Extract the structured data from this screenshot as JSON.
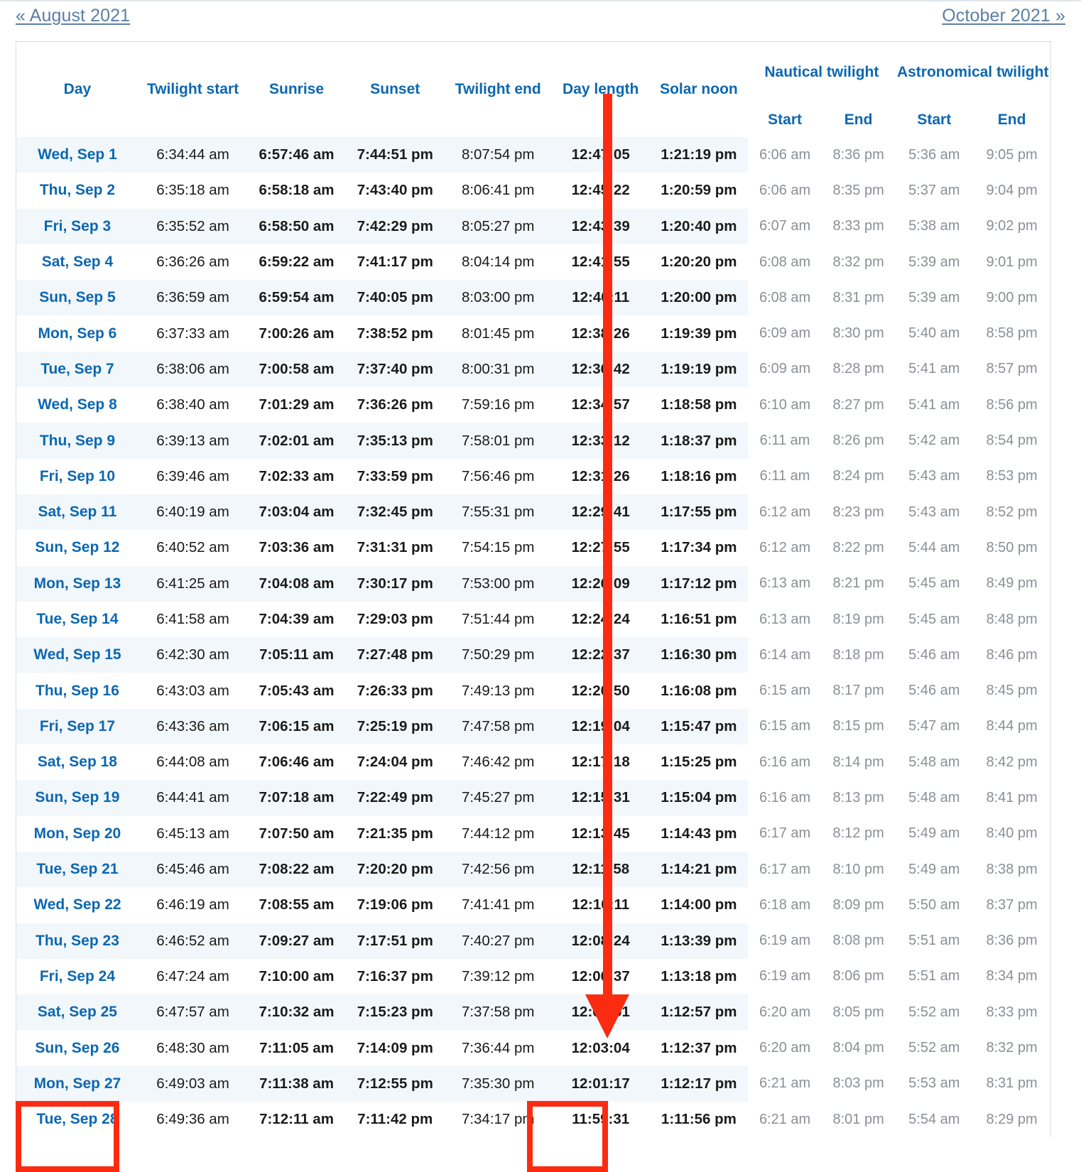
{
  "nav": {
    "prev_label": "« August 2021",
    "next_label": "October 2021 »"
  },
  "table": {
    "headers": {
      "day": "Day",
      "twilight_start": "Twilight start",
      "sunrise": "Sunrise",
      "sunset": "Sunset",
      "twilight_end": "Twilight end",
      "day_length": "Day length",
      "solar_noon": "Solar noon",
      "nautical_group": "Nautical twilight",
      "astronomical_group": "Astronomical twilight",
      "nautical_start": "Start",
      "nautical_end": "End",
      "astronomical_start": "Start",
      "astronomical_end": "End"
    },
    "rows": [
      {
        "day": "Wed, Sep 1",
        "twilight_start": "6:34:44 am",
        "sunrise": "6:57:46 am",
        "sunset": "7:44:51 pm",
        "twilight_end": "8:07:54 pm",
        "day_length": "12:47:05",
        "solar_noon": "1:21:19 pm",
        "nautical_start": "6:06 am",
        "nautical_end": "8:36 pm",
        "astronomical_start": "5:36 am",
        "astronomical_end": "9:05 pm"
      },
      {
        "day": "Thu, Sep 2",
        "twilight_start": "6:35:18 am",
        "sunrise": "6:58:18 am",
        "sunset": "7:43:40 pm",
        "twilight_end": "8:06:41 pm",
        "day_length": "12:45:22",
        "solar_noon": "1:20:59 pm",
        "nautical_start": "6:06 am",
        "nautical_end": "8:35 pm",
        "astronomical_start": "5:37 am",
        "astronomical_end": "9:04 pm"
      },
      {
        "day": "Fri, Sep 3",
        "twilight_start": "6:35:52 am",
        "sunrise": "6:58:50 am",
        "sunset": "7:42:29 pm",
        "twilight_end": "8:05:27 pm",
        "day_length": "12:43:39",
        "solar_noon": "1:20:40 pm",
        "nautical_start": "6:07 am",
        "nautical_end": "8:33 pm",
        "astronomical_start": "5:38 am",
        "astronomical_end": "9:02 pm"
      },
      {
        "day": "Sat, Sep 4",
        "twilight_start": "6:36:26 am",
        "sunrise": "6:59:22 am",
        "sunset": "7:41:17 pm",
        "twilight_end": "8:04:14 pm",
        "day_length": "12:41:55",
        "solar_noon": "1:20:20 pm",
        "nautical_start": "6:08 am",
        "nautical_end": "8:32 pm",
        "astronomical_start": "5:39 am",
        "astronomical_end": "9:01 pm"
      },
      {
        "day": "Sun, Sep 5",
        "twilight_start": "6:36:59 am",
        "sunrise": "6:59:54 am",
        "sunset": "7:40:05 pm",
        "twilight_end": "8:03:00 pm",
        "day_length": "12:40:11",
        "solar_noon": "1:20:00 pm",
        "nautical_start": "6:08 am",
        "nautical_end": "8:31 pm",
        "astronomical_start": "5:39 am",
        "astronomical_end": "9:00 pm"
      },
      {
        "day": "Mon, Sep 6",
        "twilight_start": "6:37:33 am",
        "sunrise": "7:00:26 am",
        "sunset": "7:38:52 pm",
        "twilight_end": "8:01:45 pm",
        "day_length": "12:38:26",
        "solar_noon": "1:19:39 pm",
        "nautical_start": "6:09 am",
        "nautical_end": "8:30 pm",
        "astronomical_start": "5:40 am",
        "astronomical_end": "8:58 pm"
      },
      {
        "day": "Tue, Sep 7",
        "twilight_start": "6:38:06 am",
        "sunrise": "7:00:58 am",
        "sunset": "7:37:40 pm",
        "twilight_end": "8:00:31 pm",
        "day_length": "12:36:42",
        "solar_noon": "1:19:19 pm",
        "nautical_start": "6:09 am",
        "nautical_end": "8:28 pm",
        "astronomical_start": "5:41 am",
        "astronomical_end": "8:57 pm"
      },
      {
        "day": "Wed, Sep 8",
        "twilight_start": "6:38:40 am",
        "sunrise": "7:01:29 am",
        "sunset": "7:36:26 pm",
        "twilight_end": "7:59:16 pm",
        "day_length": "12:34:57",
        "solar_noon": "1:18:58 pm",
        "nautical_start": "6:10 am",
        "nautical_end": "8:27 pm",
        "astronomical_start": "5:41 am",
        "astronomical_end": "8:56 pm"
      },
      {
        "day": "Thu, Sep 9",
        "twilight_start": "6:39:13 am",
        "sunrise": "7:02:01 am",
        "sunset": "7:35:13 pm",
        "twilight_end": "7:58:01 pm",
        "day_length": "12:33:12",
        "solar_noon": "1:18:37 pm",
        "nautical_start": "6:11 am",
        "nautical_end": "8:26 pm",
        "astronomical_start": "5:42 am",
        "astronomical_end": "8:54 pm"
      },
      {
        "day": "Fri, Sep 10",
        "twilight_start": "6:39:46 am",
        "sunrise": "7:02:33 am",
        "sunset": "7:33:59 pm",
        "twilight_end": "7:56:46 pm",
        "day_length": "12:31:26",
        "solar_noon": "1:18:16 pm",
        "nautical_start": "6:11 am",
        "nautical_end": "8:24 pm",
        "astronomical_start": "5:43 am",
        "astronomical_end": "8:53 pm"
      },
      {
        "day": "Sat, Sep 11",
        "twilight_start": "6:40:19 am",
        "sunrise": "7:03:04 am",
        "sunset": "7:32:45 pm",
        "twilight_end": "7:55:31 pm",
        "day_length": "12:29:41",
        "solar_noon": "1:17:55 pm",
        "nautical_start": "6:12 am",
        "nautical_end": "8:23 pm",
        "astronomical_start": "5:43 am",
        "astronomical_end": "8:52 pm"
      },
      {
        "day": "Sun, Sep 12",
        "twilight_start": "6:40:52 am",
        "sunrise": "7:03:36 am",
        "sunset": "7:31:31 pm",
        "twilight_end": "7:54:15 pm",
        "day_length": "12:27:55",
        "solar_noon": "1:17:34 pm",
        "nautical_start": "6:12 am",
        "nautical_end": "8:22 pm",
        "astronomical_start": "5:44 am",
        "astronomical_end": "8:50 pm"
      },
      {
        "day": "Mon, Sep 13",
        "twilight_start": "6:41:25 am",
        "sunrise": "7:04:08 am",
        "sunset": "7:30:17 pm",
        "twilight_end": "7:53:00 pm",
        "day_length": "12:26:09",
        "solar_noon": "1:17:12 pm",
        "nautical_start": "6:13 am",
        "nautical_end": "8:21 pm",
        "astronomical_start": "5:45 am",
        "astronomical_end": "8:49 pm"
      },
      {
        "day": "Tue, Sep 14",
        "twilight_start": "6:41:58 am",
        "sunrise": "7:04:39 am",
        "sunset": "7:29:03 pm",
        "twilight_end": "7:51:44 pm",
        "day_length": "12:24:24",
        "solar_noon": "1:16:51 pm",
        "nautical_start": "6:13 am",
        "nautical_end": "8:19 pm",
        "astronomical_start": "5:45 am",
        "astronomical_end": "8:48 pm"
      },
      {
        "day": "Wed, Sep 15",
        "twilight_start": "6:42:30 am",
        "sunrise": "7:05:11 am",
        "sunset": "7:27:48 pm",
        "twilight_end": "7:50:29 pm",
        "day_length": "12:22:37",
        "solar_noon": "1:16:30 pm",
        "nautical_start": "6:14 am",
        "nautical_end": "8:18 pm",
        "astronomical_start": "5:46 am",
        "astronomical_end": "8:46 pm"
      },
      {
        "day": "Thu, Sep 16",
        "twilight_start": "6:43:03 am",
        "sunrise": "7:05:43 am",
        "sunset": "7:26:33 pm",
        "twilight_end": "7:49:13 pm",
        "day_length": "12:20:50",
        "solar_noon": "1:16:08 pm",
        "nautical_start": "6:15 am",
        "nautical_end": "8:17 pm",
        "astronomical_start": "5:46 am",
        "astronomical_end": "8:45 pm"
      },
      {
        "day": "Fri, Sep 17",
        "twilight_start": "6:43:36 am",
        "sunrise": "7:06:15 am",
        "sunset": "7:25:19 pm",
        "twilight_end": "7:47:58 pm",
        "day_length": "12:19:04",
        "solar_noon": "1:15:47 pm",
        "nautical_start": "6:15 am",
        "nautical_end": "8:15 pm",
        "astronomical_start": "5:47 am",
        "astronomical_end": "8:44 pm"
      },
      {
        "day": "Sat, Sep 18",
        "twilight_start": "6:44:08 am",
        "sunrise": "7:06:46 am",
        "sunset": "7:24:04 pm",
        "twilight_end": "7:46:42 pm",
        "day_length": "12:17:18",
        "solar_noon": "1:15:25 pm",
        "nautical_start": "6:16 am",
        "nautical_end": "8:14 pm",
        "astronomical_start": "5:48 am",
        "astronomical_end": "8:42 pm"
      },
      {
        "day": "Sun, Sep 19",
        "twilight_start": "6:44:41 am",
        "sunrise": "7:07:18 am",
        "sunset": "7:22:49 pm",
        "twilight_end": "7:45:27 pm",
        "day_length": "12:15:31",
        "solar_noon": "1:15:04 pm",
        "nautical_start": "6:16 am",
        "nautical_end": "8:13 pm",
        "astronomical_start": "5:48 am",
        "astronomical_end": "8:41 pm"
      },
      {
        "day": "Mon, Sep 20",
        "twilight_start": "6:45:13 am",
        "sunrise": "7:07:50 am",
        "sunset": "7:21:35 pm",
        "twilight_end": "7:44:12 pm",
        "day_length": "12:13:45",
        "solar_noon": "1:14:43 pm",
        "nautical_start": "6:17 am",
        "nautical_end": "8:12 pm",
        "astronomical_start": "5:49 am",
        "astronomical_end": "8:40 pm"
      },
      {
        "day": "Tue, Sep 21",
        "twilight_start": "6:45:46 am",
        "sunrise": "7:08:22 am",
        "sunset": "7:20:20 pm",
        "twilight_end": "7:42:56 pm",
        "day_length": "12:11:58",
        "solar_noon": "1:14:21 pm",
        "nautical_start": "6:17 am",
        "nautical_end": "8:10 pm",
        "astronomical_start": "5:49 am",
        "astronomical_end": "8:38 pm"
      },
      {
        "day": "Wed, Sep 22",
        "twilight_start": "6:46:19 am",
        "sunrise": "7:08:55 am",
        "sunset": "7:19:06 pm",
        "twilight_end": "7:41:41 pm",
        "day_length": "12:10:11",
        "solar_noon": "1:14:00 pm",
        "nautical_start": "6:18 am",
        "nautical_end": "8:09 pm",
        "astronomical_start": "5:50 am",
        "astronomical_end": "8:37 pm"
      },
      {
        "day": "Thu, Sep 23",
        "twilight_start": "6:46:52 am",
        "sunrise": "7:09:27 am",
        "sunset": "7:17:51 pm",
        "twilight_end": "7:40:27 pm",
        "day_length": "12:08:24",
        "solar_noon": "1:13:39 pm",
        "nautical_start": "6:19 am",
        "nautical_end": "8:08 pm",
        "astronomical_start": "5:51 am",
        "astronomical_end": "8:36 pm"
      },
      {
        "day": "Fri, Sep 24",
        "twilight_start": "6:47:24 am",
        "sunrise": "7:10:00 am",
        "sunset": "7:16:37 pm",
        "twilight_end": "7:39:12 pm",
        "day_length": "12:06:37",
        "solar_noon": "1:13:18 pm",
        "nautical_start": "6:19 am",
        "nautical_end": "8:06 pm",
        "astronomical_start": "5:51 am",
        "astronomical_end": "8:34 pm"
      },
      {
        "day": "Sat, Sep 25",
        "twilight_start": "6:47:57 am",
        "sunrise": "7:10:32 am",
        "sunset": "7:15:23 pm",
        "twilight_end": "7:37:58 pm",
        "day_length": "12:04:51",
        "solar_noon": "1:12:57 pm",
        "nautical_start": "6:20 am",
        "nautical_end": "8:05 pm",
        "astronomical_start": "5:52 am",
        "astronomical_end": "8:33 pm"
      },
      {
        "day": "Sun, Sep 26",
        "twilight_start": "6:48:30 am",
        "sunrise": "7:11:05 am",
        "sunset": "7:14:09 pm",
        "twilight_end": "7:36:44 pm",
        "day_length": "12:03:04",
        "solar_noon": "1:12:37 pm",
        "nautical_start": "6:20 am",
        "nautical_end": "8:04 pm",
        "astronomical_start": "5:52 am",
        "astronomical_end": "8:32 pm"
      },
      {
        "day": "Mon, Sep 27",
        "twilight_start": "6:49:03 am",
        "sunrise": "7:11:38 am",
        "sunset": "7:12:55 pm",
        "twilight_end": "7:35:30 pm",
        "day_length": "12:01:17",
        "solar_noon": "1:12:17 pm",
        "nautical_start": "6:21 am",
        "nautical_end": "8:03 pm",
        "astronomical_start": "5:53 am",
        "astronomical_end": "8:31 pm"
      },
      {
        "day": "Tue, Sep 28",
        "twilight_start": "6:49:36 am",
        "sunrise": "7:12:11 am",
        "sunset": "7:11:42 pm",
        "twilight_end": "7:34:17 pm",
        "day_length": "11:59:31",
        "solar_noon": "1:11:56 pm",
        "nautical_start": "6:21 am",
        "nautical_end": "8:01 pm",
        "astronomical_start": "5:54 am",
        "astronomical_end": "8:29 pm"
      }
    ]
  },
  "annotations": {
    "color": "#fb2b11",
    "arrow": "down-arrow-annotation",
    "highlight_day_rows": [
      "Mon, Sep 27",
      "Tue, Sep 28"
    ],
    "highlight_day_length_values": [
      "12:01:17",
      "11:59:31"
    ]
  }
}
